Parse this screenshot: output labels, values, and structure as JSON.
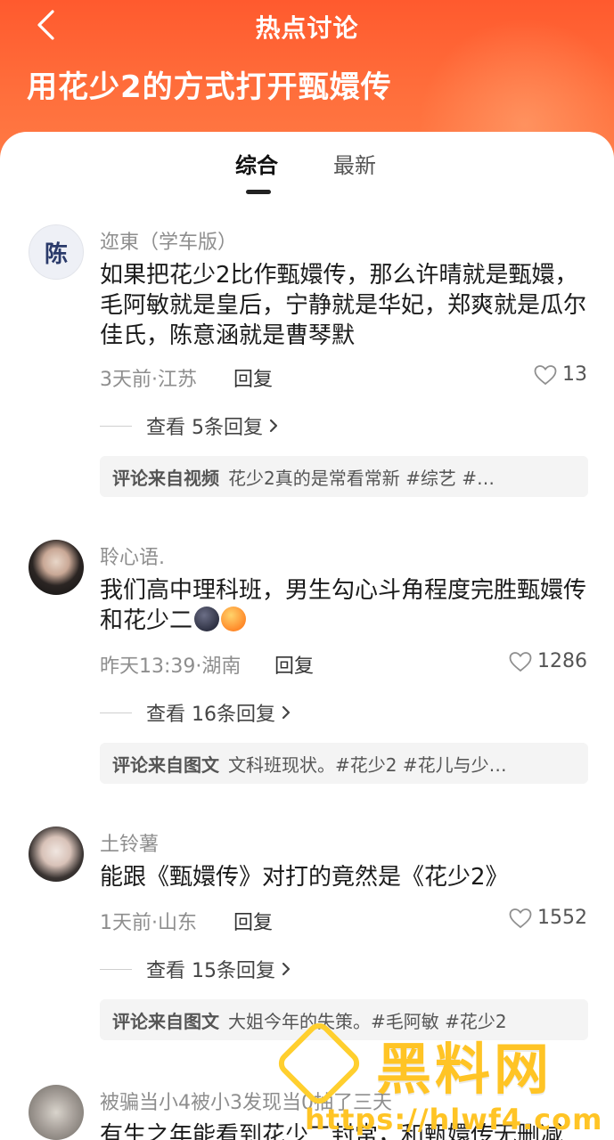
{
  "header": {
    "title": "热点讨论",
    "topic_title": "用花少2的方式打开甄嬛传"
  },
  "tabs": [
    {
      "label": "综合",
      "active": true
    },
    {
      "label": "最新",
      "active": false
    }
  ],
  "comments": [
    {
      "avatar_text": "陈",
      "username": "迩東（学车版）",
      "content": "如果把花少2比作甄嬛传，那么许晴就是甄嬛，毛阿敏就是皇后，宁静就是华妃，郑爽就是瓜尔佳氏，陈意涵就是曹琴默",
      "time_location": "3天前·江苏",
      "reply_label": "回复",
      "likes": "13",
      "view_replies": "查看 5条回复",
      "source_label": "评论来自视频",
      "source_text": "花少2真的是常看常新 #综艺 #…"
    },
    {
      "username": "聆心语.",
      "content": "我们高中理科班，男生勾心斗角程度完胜甄嬛传和花少二",
      "time_location": "昨天13:39·湖南",
      "reply_label": "回复",
      "likes": "1286",
      "view_replies": "查看 16条回复",
      "source_label": "评论来自图文",
      "source_text": "文科班现状。#花少2 #花儿与少…"
    },
    {
      "username": "土铃薯",
      "content": "能跟《甄嬛传》对打的竟然是《花少2》",
      "time_location": "1天前·山东",
      "reply_label": "回复",
      "likes": "1552",
      "view_replies": "查看 15条回复",
      "source_label": "评论来自图文",
      "source_text": "大姐今年的失策。#毛阿敏 #花少2"
    },
    {
      "username": "被骗当小4被小3发现当0抽了三天",
      "content": "有生之年能看到花少二封常，和甄嬛传无删减"
    }
  ],
  "watermark": {
    "name": "黑料网",
    "url": "https://hlwf4.com"
  },
  "colors": {
    "header_orange": "#ff5a2e",
    "watermark_yellow": "#ffc425"
  }
}
